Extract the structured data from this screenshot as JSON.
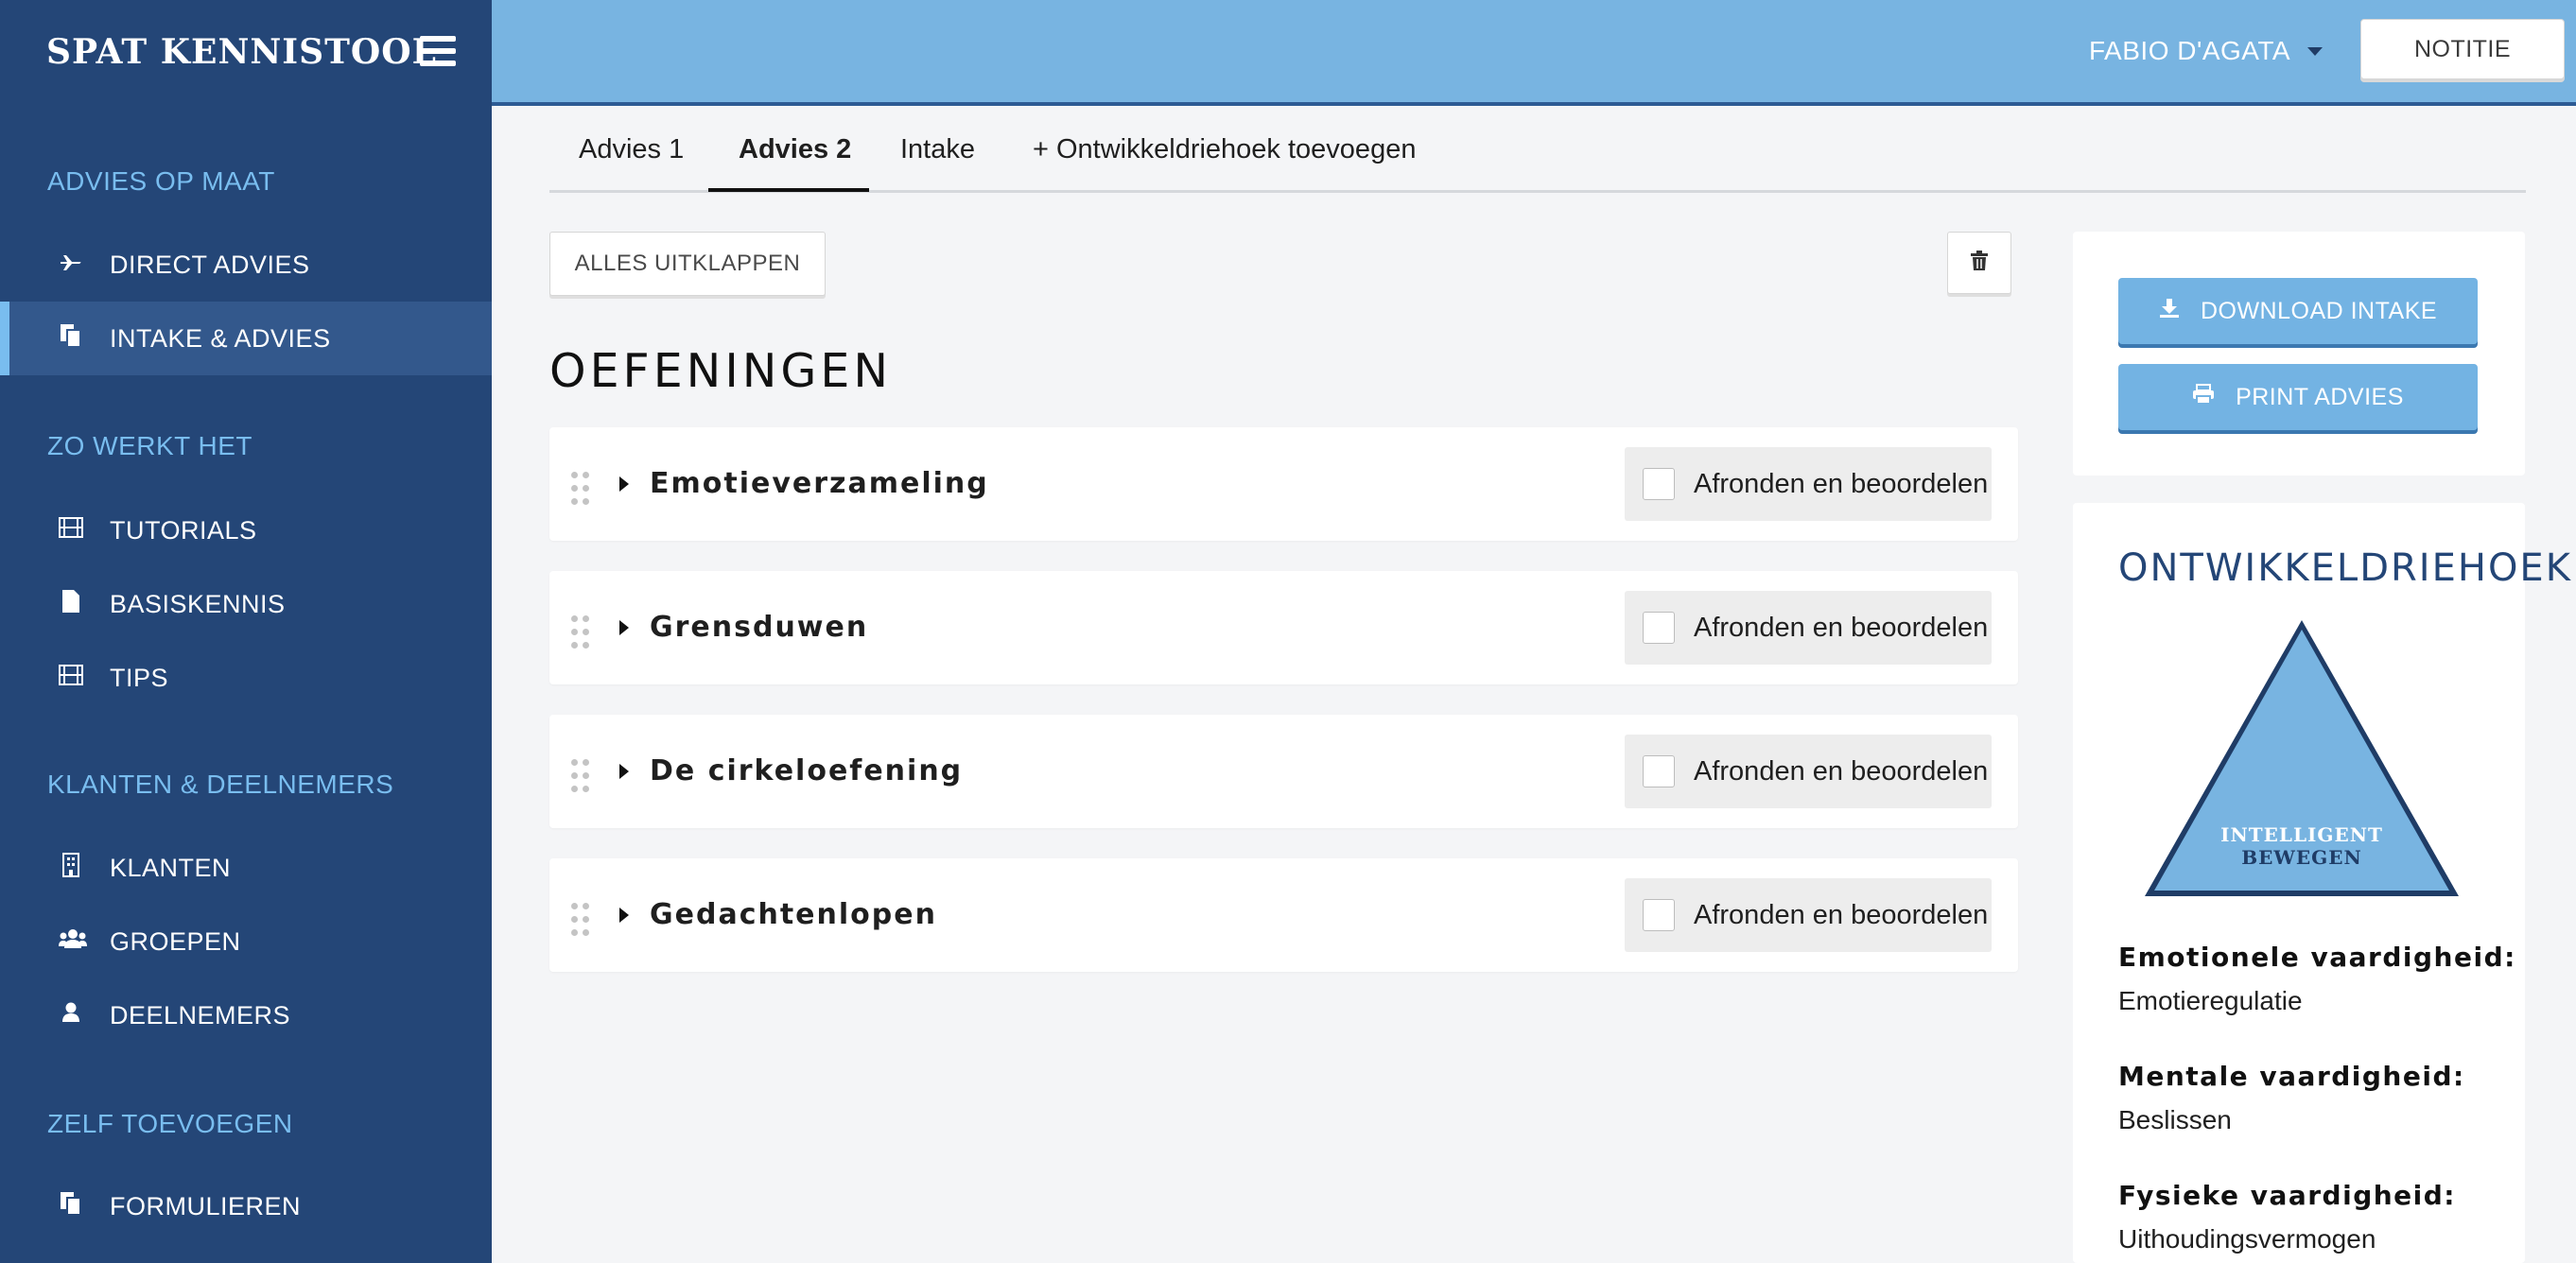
{
  "sidebar": {
    "brand": "SPAT KENNISTOOL",
    "sections": {
      "advies": "ADVIES OP MAAT",
      "werkt": "ZO WERKT HET",
      "klanten": "KLANTEN & DEELNEMERS",
      "zelf": "ZELF TOEVOEGEN"
    },
    "items": {
      "direct_advies": "DIRECT ADVIES",
      "intake_advies": "INTAKE & ADVIES",
      "tutorials": "TUTORIALS",
      "basiskennis": "BASISKENNIS",
      "tips": "TIPS",
      "klanten": "KLANTEN",
      "groepen": "GROEPEN",
      "deelnemers": "DEELNEMERS",
      "formulieren": "FORMULIEREN"
    },
    "active_item": "INTAKE & ADVIES"
  },
  "topbar": {
    "user": "FABIO D'AGATA",
    "notitie": "NOTITIE"
  },
  "tabs": {
    "advies1": "Advies 1",
    "advies2": "Advies 2",
    "intake": "Intake",
    "add": "+ Ontwikkeldriehoek toevoegen",
    "active": "Advies 2"
  },
  "main": {
    "alles_uitklappen": "ALLES UITKLAPPEN",
    "heading": "OEFENINGEN",
    "exercises": [
      {
        "title": "Emotieverzameling",
        "finish_label": "Afronden en beoordelen",
        "checked": false
      },
      {
        "title": "Grensduwen",
        "finish_label": "Afronden en beoordelen",
        "checked": false
      },
      {
        "title": "De cirkeloefening",
        "finish_label": "Afronden en beoordelen",
        "checked": false
      },
      {
        "title": "Gedachtenlopen",
        "finish_label": "Afronden en beoordelen",
        "checked": false
      }
    ]
  },
  "right_panel": {
    "download_intake": "DOWNLOAD INTAKE",
    "print_advies": "PRINT ADVIES",
    "od_title": "ONTWIKKELDRIEHOEK",
    "triangle_text_line1": "INTELLIGENT",
    "triangle_text_line2": "BEWEGEN",
    "emotional_label": "Emotionele vaardigheid:",
    "emotional_value": "Emotieregulatie",
    "mental_label": "Mentale vaardigheid:",
    "mental_value": "Beslissen",
    "physical_label": "Fysieke vaardigheid:",
    "physical_value": "Uithoudingsvermogen"
  },
  "colors": {
    "sidebar_bg": "#244677",
    "sidebar_active": "#33588c",
    "accent_light": "#79bdef",
    "topbar_bg": "#78b4e1",
    "button_blue": "#73b3e3",
    "triangle_fill": "#78b4e1",
    "triangle_stroke": "#1f3c66"
  },
  "icons": {
    "direct_advies": "plane-icon",
    "intake_advies": "copy-icon",
    "tutorials": "film-icon",
    "basiskennis": "file-icon",
    "tips": "film-icon",
    "klanten": "building-icon",
    "groepen": "users-icon",
    "deelnemers": "user-icon",
    "formulieren": "copy-icon",
    "download": "download-icon",
    "print": "print-icon",
    "trash": "trash-icon"
  }
}
